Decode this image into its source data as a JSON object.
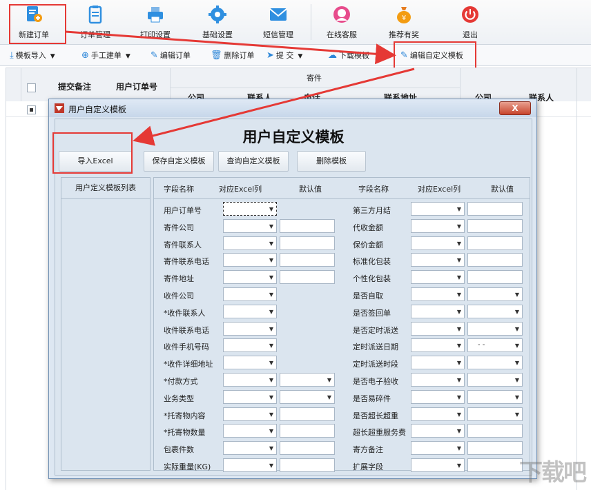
{
  "toolbar": {
    "items": [
      {
        "label": "新建订单",
        "icon": "new-order-icon"
      },
      {
        "label": "订单管理",
        "icon": "clipboard-icon"
      },
      {
        "label": "打印设置",
        "icon": "printer-icon"
      },
      {
        "label": "基础设置",
        "icon": "gear-icon"
      },
      {
        "label": "短信管理",
        "icon": "envelope-icon"
      },
      {
        "label": "在线客服",
        "icon": "support-icon"
      },
      {
        "label": "推荐有奖",
        "icon": "money-bag-icon"
      },
      {
        "label": "退出",
        "icon": "power-icon"
      }
    ]
  },
  "subtoolbar": {
    "import_template": "模板导入",
    "manual_order": "手工建单",
    "edit_order": "编辑订单",
    "delete_order": "删除订单",
    "submit": "提 交",
    "download_template": "下载模板",
    "edit_custom_template": "编辑自定义模板"
  },
  "grid": {
    "submit_note": "提交备注",
    "user_order_no": "用户订单号",
    "sender_group": "寄件",
    "company": "公司",
    "contact": "联系人",
    "phone": "电话",
    "address": "联系地址",
    "company2": "公司",
    "contact2": "联系人"
  },
  "dialog": {
    "title": "用户自定义模板",
    "heading": "用户自定义模板",
    "close": "X",
    "buttons": {
      "import_excel": "导入Excel",
      "save": "保存自定义模板",
      "query": "查询自定义模板",
      "delete": "删除模板"
    },
    "left_header": "用户定义模板列表",
    "columns": [
      "字段名称",
      "对应Excel列",
      "默认值",
      "字段名称",
      "对应Excel列",
      "默认值"
    ],
    "left_fields": [
      {
        "label": "用户订单号",
        "default": "none"
      },
      {
        "label": "寄件公司",
        "default": "text"
      },
      {
        "label": "寄件联系人",
        "default": "text"
      },
      {
        "label": "寄件联系电话",
        "default": "text"
      },
      {
        "label": "寄件地址",
        "default": "text"
      },
      {
        "label": "收件公司",
        "default": "none"
      },
      {
        "label": "*收件联系人",
        "default": "none"
      },
      {
        "label": "收件联系电话",
        "default": "none"
      },
      {
        "label": "收件手机号码",
        "default": "none"
      },
      {
        "label": "*收件详细地址",
        "default": "none"
      },
      {
        "label": "*付款方式",
        "default": "select"
      },
      {
        "label": "业务类型",
        "default": "select"
      },
      {
        "label": "*托寄物内容",
        "default": "text"
      },
      {
        "label": "*托寄物数量",
        "default": "text"
      },
      {
        "label": "包裹件数",
        "default": "text"
      },
      {
        "label": "实际重量(KG)",
        "default": "text"
      }
    ],
    "right_fields": [
      {
        "label": "第三方月结",
        "default": "text"
      },
      {
        "label": "代收金额",
        "default": "text"
      },
      {
        "label": "保价金额",
        "default": "text"
      },
      {
        "label": "标准化包装",
        "default": "text"
      },
      {
        "label": "个性化包装",
        "default": "text"
      },
      {
        "label": "是否自取",
        "default": "select"
      },
      {
        "label": "是否签回单",
        "default": "select"
      },
      {
        "label": "是否定时派送",
        "default": "select"
      },
      {
        "label": "定时派送日期",
        "default": "date"
      },
      {
        "label": "定时派送时段",
        "default": "select"
      },
      {
        "label": "是否电子验收",
        "default": "select"
      },
      {
        "label": "是否易碎件",
        "default": "select"
      },
      {
        "label": "是否超长超重",
        "default": "select"
      },
      {
        "label": "超长超重服务费",
        "default": "text"
      },
      {
        "label": "寄方备注",
        "default": "text"
      },
      {
        "label": "扩展字段",
        "default": "text"
      }
    ],
    "date_placeholder": "- -"
  },
  "watermark": "下载吧",
  "colors": {
    "accent": "#2c86d8",
    "highlight": "#e53935",
    "dialog_bg": "#dbe5ef"
  }
}
